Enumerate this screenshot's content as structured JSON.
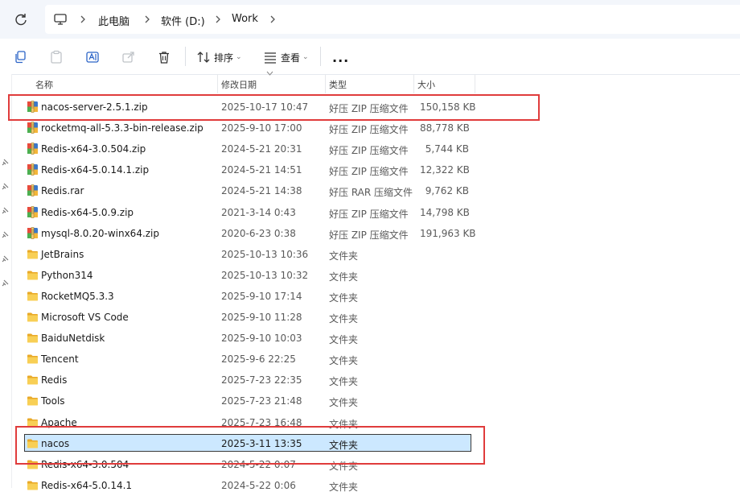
{
  "address": {
    "crumbs": [
      "此电脑",
      "软件 (D:)",
      "Work"
    ]
  },
  "toolbar": {
    "sort_label": "排序",
    "view_label": "查看",
    "more_label": "..."
  },
  "columns": {
    "name": "名称",
    "date": "修改日期",
    "type": "类型",
    "size": "大小"
  },
  "files": [
    {
      "name": "nacos-server-2.5.1.zip",
      "date": "2025-10-17 10:47",
      "type": "好压 ZIP 压缩文件",
      "size": "150,158 KB",
      "icon": "archive-icon"
    },
    {
      "name": "rocketmq-all-5.3.3-bin-release.zip",
      "date": "2025-9-10 17:00",
      "type": "好压 ZIP 压缩文件",
      "size": "88,778 KB",
      "icon": "archive-icon"
    },
    {
      "name": "Redis-x64-3.0.504.zip",
      "date": "2024-5-21 20:31",
      "type": "好压 ZIP 压缩文件",
      "size": "5,744 KB",
      "icon": "archive-icon"
    },
    {
      "name": "Redis-x64-5.0.14.1.zip",
      "date": "2024-5-21 14:51",
      "type": "好压 ZIP 压缩文件",
      "size": "12,322 KB",
      "icon": "archive-icon"
    },
    {
      "name": "Redis.rar",
      "date": "2024-5-21 14:38",
      "type": "好压 RAR 压缩文件",
      "size": "9,762 KB",
      "icon": "archive-icon"
    },
    {
      "name": "Redis-x64-5.0.9.zip",
      "date": "2021-3-14 0:43",
      "type": "好压 ZIP 压缩文件",
      "size": "14,798 KB",
      "icon": "archive-icon"
    },
    {
      "name": "mysql-8.0.20-winx64.zip",
      "date": "2020-6-23 0:38",
      "type": "好压 ZIP 压缩文件",
      "size": "191,963 KB",
      "icon": "archive-icon"
    },
    {
      "name": "JetBrains",
      "date": "2025-10-13 10:36",
      "type": "文件夹",
      "size": "",
      "icon": "folder-icon"
    },
    {
      "name": "Python314",
      "date": "2025-10-13 10:32",
      "type": "文件夹",
      "size": "",
      "icon": "folder-icon"
    },
    {
      "name": "RocketMQ5.3.3",
      "date": "2025-9-10 17:14",
      "type": "文件夹",
      "size": "",
      "icon": "folder-icon"
    },
    {
      "name": "Microsoft VS Code",
      "date": "2025-9-10 11:28",
      "type": "文件夹",
      "size": "",
      "icon": "folder-icon"
    },
    {
      "name": "BaiduNetdisk",
      "date": "2025-9-10 10:03",
      "type": "文件夹",
      "size": "",
      "icon": "folder-icon"
    },
    {
      "name": "Tencent",
      "date": "2025-9-6 22:25",
      "type": "文件夹",
      "size": "",
      "icon": "folder-icon"
    },
    {
      "name": "Redis",
      "date": "2025-7-23 22:35",
      "type": "文件夹",
      "size": "",
      "icon": "folder-icon"
    },
    {
      "name": "Tools",
      "date": "2025-7-23 21:48",
      "type": "文件夹",
      "size": "",
      "icon": "folder-icon"
    },
    {
      "name": "Apache",
      "date": "2025-7-23 16:48",
      "type": "文件夹",
      "size": "",
      "icon": "folder-icon"
    },
    {
      "name": "nacos",
      "date": "2025-3-11 13:35",
      "type": "文件夹",
      "size": "",
      "icon": "folder-icon",
      "selected": true
    },
    {
      "name": "Redis-x64-3.0.504",
      "date": "2024-5-22 0:07",
      "type": "文件夹",
      "size": "",
      "icon": "folder-icon"
    },
    {
      "name": "Redis-x64-5.0.14.1",
      "date": "2024-5-22 0:06",
      "type": "文件夹",
      "size": "",
      "icon": "folder-icon"
    }
  ],
  "colors": {
    "accent_selection": "#cce8ff",
    "annotation_red": "#e03c3c",
    "folder_yellow": "#f5c242"
  }
}
